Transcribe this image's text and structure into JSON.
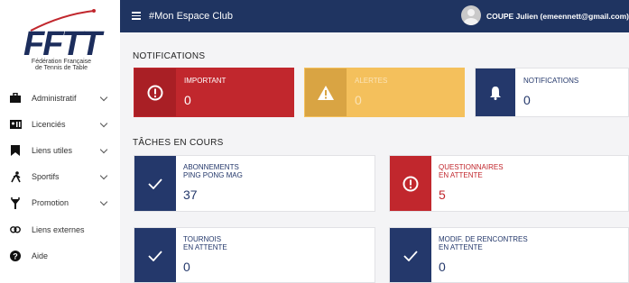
{
  "app": {
    "logo_text": "FFTT",
    "logo_subtitle_1": "Fédération Française",
    "logo_subtitle_2": "de Tennis de Table"
  },
  "topbar": {
    "title": "#Mon Espace Club",
    "user": "COUPE Julien (emeennett@gmail.com)"
  },
  "sidebar": {
    "items": [
      {
        "label": "Administratif",
        "icon": "briefcase-icon",
        "has_chevron": true
      },
      {
        "label": "Licenciés",
        "icon": "id-card-icon",
        "has_chevron": true
      },
      {
        "label": "Liens utiles",
        "icon": "bookmark-icon",
        "has_chevron": true
      },
      {
        "label": "Sportifs",
        "icon": "running-icon",
        "has_chevron": true
      },
      {
        "label": "Promotion",
        "icon": "megaphone-icon",
        "has_chevron": true
      },
      {
        "label": "Liens externes",
        "icon": "link-icon",
        "has_chevron": false
      },
      {
        "label": "Aide",
        "icon": "help-icon",
        "has_chevron": false
      }
    ]
  },
  "notifications": {
    "section_title": "NOTIFICATIONS",
    "cards": [
      {
        "label": "IMPORTANT",
        "value": "0",
        "icon": "alert-circle-icon"
      },
      {
        "label": "ALERTES",
        "value": "0",
        "icon": "warning-icon"
      },
      {
        "label": "NOTIFICATIONS",
        "value": "0",
        "icon": "bell-icon"
      }
    ]
  },
  "tasks": {
    "section_title": "TÂCHES EN COURS",
    "cards": [
      {
        "label_1": "ABONNEMENTS",
        "label_2": "PING PONG MAG",
        "value": "37",
        "icon": "check-icon"
      },
      {
        "label_1": "QUESTIONNAIRES",
        "label_2": "EN ATTENTE",
        "value": "5",
        "icon": "alert-circle-icon"
      },
      {
        "label_1": "TOURNOIS",
        "label_2": "EN ATTENTE",
        "value": "0",
        "icon": "check-icon"
      },
      {
        "label_1": "MODIF. DE RENCONTRES",
        "label_2": "EN ATTENTE",
        "value": "0",
        "icon": "check-icon"
      }
    ]
  },
  "colors": {
    "navy": "#1f3461",
    "red": "#c1272d",
    "yellow": "#f4c05c"
  }
}
